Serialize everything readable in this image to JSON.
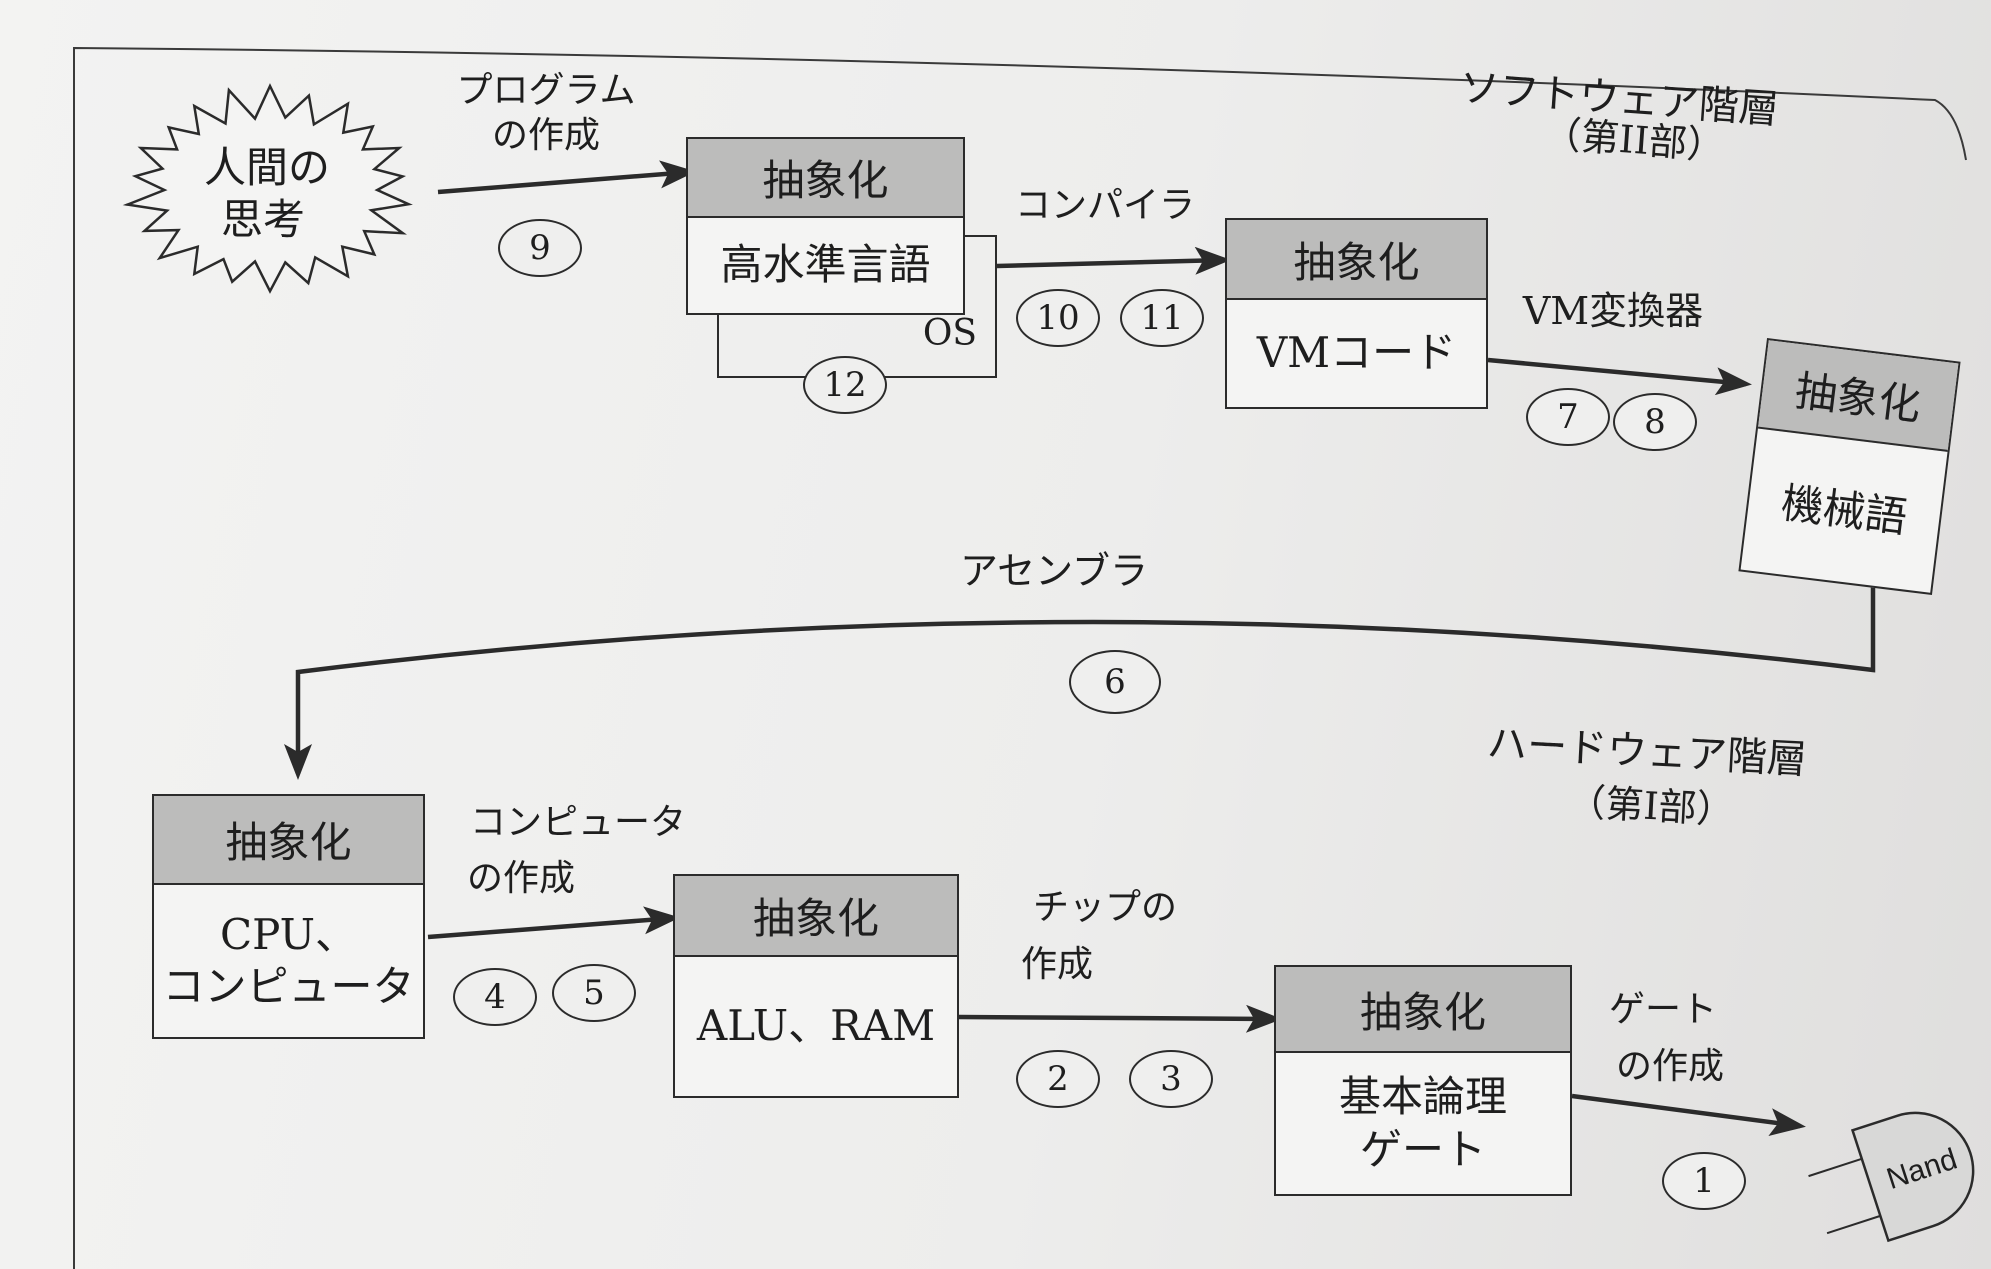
{
  "thought": {
    "line1": "人間の",
    "line2": "思考"
  },
  "layers": {
    "software": {
      "title": "ソフトウェア階層",
      "part": "（第II部）"
    },
    "hardware": {
      "title": "ハードウェア階層",
      "part": "（第I部）"
    }
  },
  "boxes": {
    "high_level": {
      "header": "抽象化",
      "body": "高水準言語"
    },
    "os": {
      "label": "OS",
      "chapters": [
        "12"
      ]
    },
    "vm": {
      "header": "抽象化",
      "body": "VMコード"
    },
    "machine": {
      "header": "抽象化",
      "body": "機械語"
    },
    "computer": {
      "header": "抽象化",
      "body": [
        "CPU、",
        "コンピュータ"
      ]
    },
    "chips": {
      "header": "抽象化",
      "body": "ALU、RAM"
    },
    "gates": {
      "header": "抽象化",
      "body": [
        "基本論理",
        "ゲート"
      ]
    }
  },
  "steps": {
    "program": {
      "label1": "プログラム",
      "label2": "の作成",
      "chapters": [
        "9"
      ]
    },
    "compiler": {
      "label": "コンパイラ",
      "chapters": [
        "10",
        "11"
      ]
    },
    "vm_translator": {
      "label": "VM変換器",
      "chapters": [
        "7",
        "8"
      ]
    },
    "assembler": {
      "label": "アセンブラ",
      "chapters": [
        "6"
      ]
    },
    "computer": {
      "label1": "コンピュータ",
      "label2": "の作成",
      "chapters": [
        "4",
        "5"
      ]
    },
    "chips": {
      "label1": "チップの",
      "label2": "作成",
      "chapters": [
        "2",
        "3"
      ]
    },
    "gates": {
      "label1": "ゲート",
      "label2": "の作成",
      "chapters": [
        "1"
      ]
    }
  },
  "nand_gate": {
    "label": "Nand"
  }
}
